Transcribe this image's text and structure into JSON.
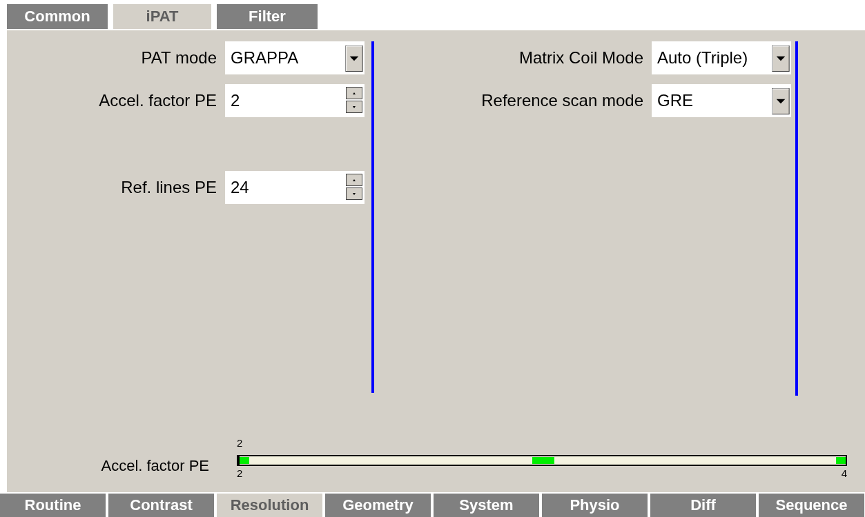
{
  "top_tabs": [
    {
      "label": "Common",
      "selected": false
    },
    {
      "label": "iPAT",
      "selected": true
    },
    {
      "label": "Filter",
      "selected": false
    }
  ],
  "left_fields": [
    {
      "label": "PAT mode",
      "value": "GRAPPA",
      "kind": "dropdown"
    },
    {
      "label": "Accel. factor PE",
      "value": "2",
      "kind": "spinner"
    },
    {
      "label": "Ref. lines PE",
      "value": "24",
      "kind": "spinner"
    }
  ],
  "right_fields": [
    {
      "label": "Matrix Coil Mode",
      "value": "Auto (Triple)",
      "kind": "dropdown"
    },
    {
      "label": "Reference scan mode",
      "value": "GRE",
      "kind": "dropdown"
    }
  ],
  "slider": {
    "label": "Accel. factor PE",
    "value": "2",
    "min": "2",
    "max": "4",
    "level": 0
  },
  "bottom_tabs": [
    {
      "label": "Routine",
      "selected": false
    },
    {
      "label": "Contrast",
      "selected": false
    },
    {
      "label": "Resolution",
      "selected": true
    },
    {
      "label": "Geometry",
      "selected": false
    },
    {
      "label": "System",
      "selected": false
    },
    {
      "label": "Physio",
      "selected": false
    },
    {
      "label": "Diff",
      "selected": false
    },
    {
      "label": "Sequence",
      "selected": false
    }
  ]
}
